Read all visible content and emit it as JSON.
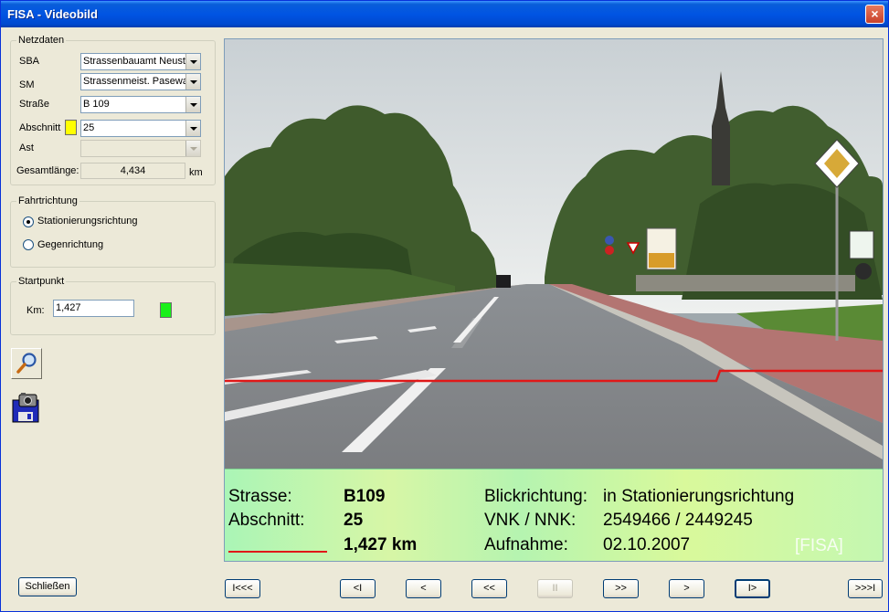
{
  "window": {
    "title": "FISA - Videobild",
    "close_label": "×"
  },
  "netzdaten": {
    "legend": "Netzdaten",
    "sba_label": "SBA",
    "sba_value": "Strassenbauamt Neustrelitz",
    "sm_label": "SM",
    "sm_value": "Strassenmeist. Pasewalk",
    "strasse_label": "Straße",
    "strasse_value": "B 109",
    "abschnitt_label": "Abschnitt",
    "abschnitt_value": "25",
    "ast_label": "Ast",
    "ast_value": "",
    "gesamt_label": "Gesamtlänge:",
    "gesamt_value": "4,434",
    "gesamt_unit": "km"
  },
  "fahrtrichtung": {
    "legend": "Fahrtrichtung",
    "option1": "Stationierungsrichtung",
    "option2": "Gegenrichtung"
  },
  "startpunkt": {
    "legend": "Startpunkt",
    "km_label": "Km:",
    "km_value": "1,427"
  },
  "tools": {
    "search": "magnifier-icon",
    "save_photo": "camera-save-icon"
  },
  "close_button_label": "Schließen",
  "nav": {
    "first": "I<<<",
    "prev_frame": "<I",
    "prev": "<",
    "rew": "<<",
    "pause": "II",
    "ffwd": ">>",
    "next": ">",
    "next_frame": "I>",
    "last": ">>>I"
  },
  "overlay": {
    "strasse_label": "Strasse:",
    "strasse_value": "B109",
    "abschnitt_label": "Abschnitt:",
    "abschnitt_value": "25",
    "km_value": "1,427 km",
    "blick_label": "Blickrichtung:",
    "blick_value": "in Stationierungsrichtung",
    "vnk_label": "VNK / NNK:",
    "vnk_value": "2549466 / 2449245",
    "aufnahme_label": "Aufnahme:",
    "aufnahme_value": "02.10.2007",
    "watermark": "[FISA]"
  },
  "colors": {
    "abschnitt_swatch": "#ffff00",
    "start_swatch": "#19ef19",
    "track_line": "#e01818"
  }
}
